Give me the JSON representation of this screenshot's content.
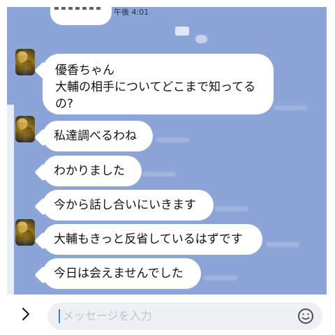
{
  "chat": {
    "top_time": "午後 4:01",
    "messages": [
      {
        "id": "m1",
        "lines": [
          "優香ちゃん",
          "大輔の相手についてどこまで知ってる",
          "の?"
        ]
      },
      {
        "id": "m2",
        "lines": [
          "私達調べるわね"
        ]
      },
      {
        "id": "m3",
        "lines": [
          "わかりました"
        ]
      },
      {
        "id": "m4",
        "lines": [
          "今から話し合いにいきます"
        ]
      },
      {
        "id": "m5",
        "lines": [
          "大輔もきっと反省しているはずです"
        ]
      },
      {
        "id": "m6",
        "lines": [
          "今日は会えませんでした"
        ]
      }
    ]
  },
  "composer": {
    "placeholder": "メッセージを入力",
    "chevron_icon": "chevron-right-icon",
    "emoji_icon": "smiley-icon"
  },
  "colors": {
    "chat_background": "#8ca5d8",
    "bubble": "#ffffff",
    "composer_background": "#ffffff",
    "input_background": "#eef0f3",
    "cursor": "#3d7cff"
  }
}
